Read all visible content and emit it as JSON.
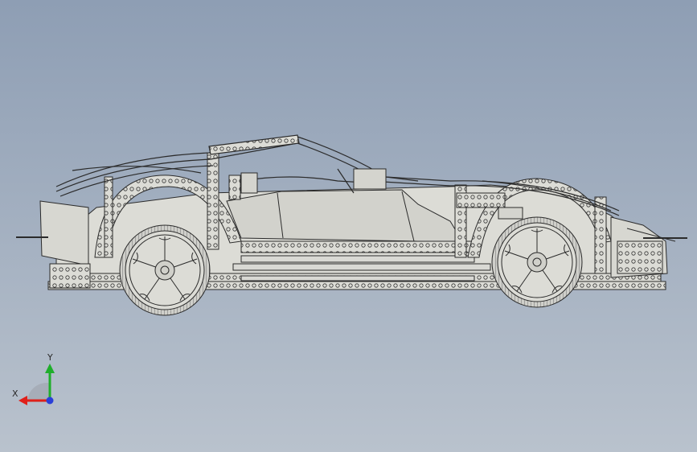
{
  "viewport": {
    "background_top": "#8e9eb4",
    "background_bottom": "#b9c2cd",
    "model_stroke": "#2b2b2b",
    "model_fill": "#d9d9d4"
  },
  "model": {
    "icon": "car-model-icon",
    "view": "side-wireframe"
  },
  "triad": {
    "x_label": "X",
    "y_label": "Y",
    "x_color": "#e0201a",
    "y_color": "#1fae2b",
    "z_color": "#2a3fd8"
  }
}
